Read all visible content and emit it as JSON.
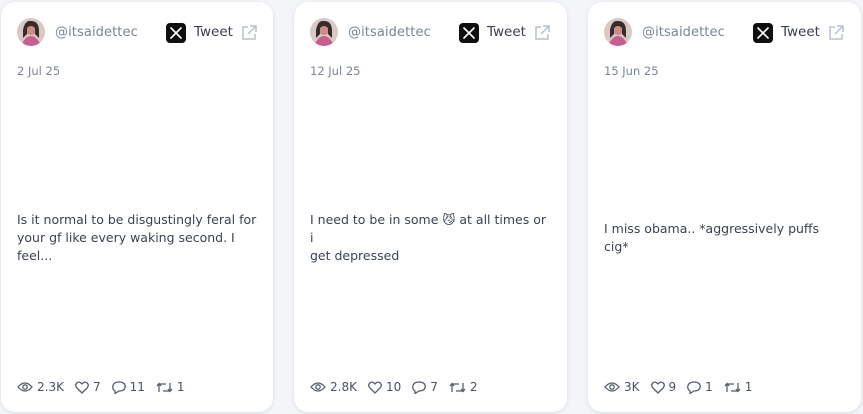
{
  "cards": [
    {
      "handle": "@itsaidettec",
      "tweet_label": "Tweet",
      "date": "2 Jul 25",
      "text_line1": "Is it normal to be disgustingly feral for",
      "text_line2": "your gf like every waking second. I feel...",
      "views": "2.3K",
      "likes": "7",
      "replies": "11",
      "retweets": "1"
    },
    {
      "handle": "@itsaidettec",
      "tweet_label": "Tweet",
      "date": "12 Jul 25",
      "text_line1_pre": "I need to be in some",
      "emoji": "😼",
      "text_line1_post": "at all times or i",
      "text_line2": "get depressed",
      "views": "2.8K",
      "likes": "10",
      "replies": "7",
      "retweets": "2"
    },
    {
      "handle": "@itsaidettec",
      "tweet_label": "Tweet",
      "date": "15 Jun 25",
      "text_line1": "I miss obama.. *aggressively puffs cig*",
      "views": "3K",
      "likes": "9",
      "replies": "1",
      "retweets": "1"
    }
  ],
  "colors": {
    "background": "#f3f5f9",
    "card": "#ffffff",
    "muted_text": "#7b8494",
    "body_text": "#3b4250",
    "x_badge": "#0f0f0f"
  },
  "icons": {
    "avatar": "avatar-photo",
    "x_logo": "x-logo-icon",
    "external": "external-link-icon",
    "views": "eye-icon",
    "likes": "heart-icon",
    "replies": "comment-icon",
    "retweets": "retweet-icon"
  }
}
